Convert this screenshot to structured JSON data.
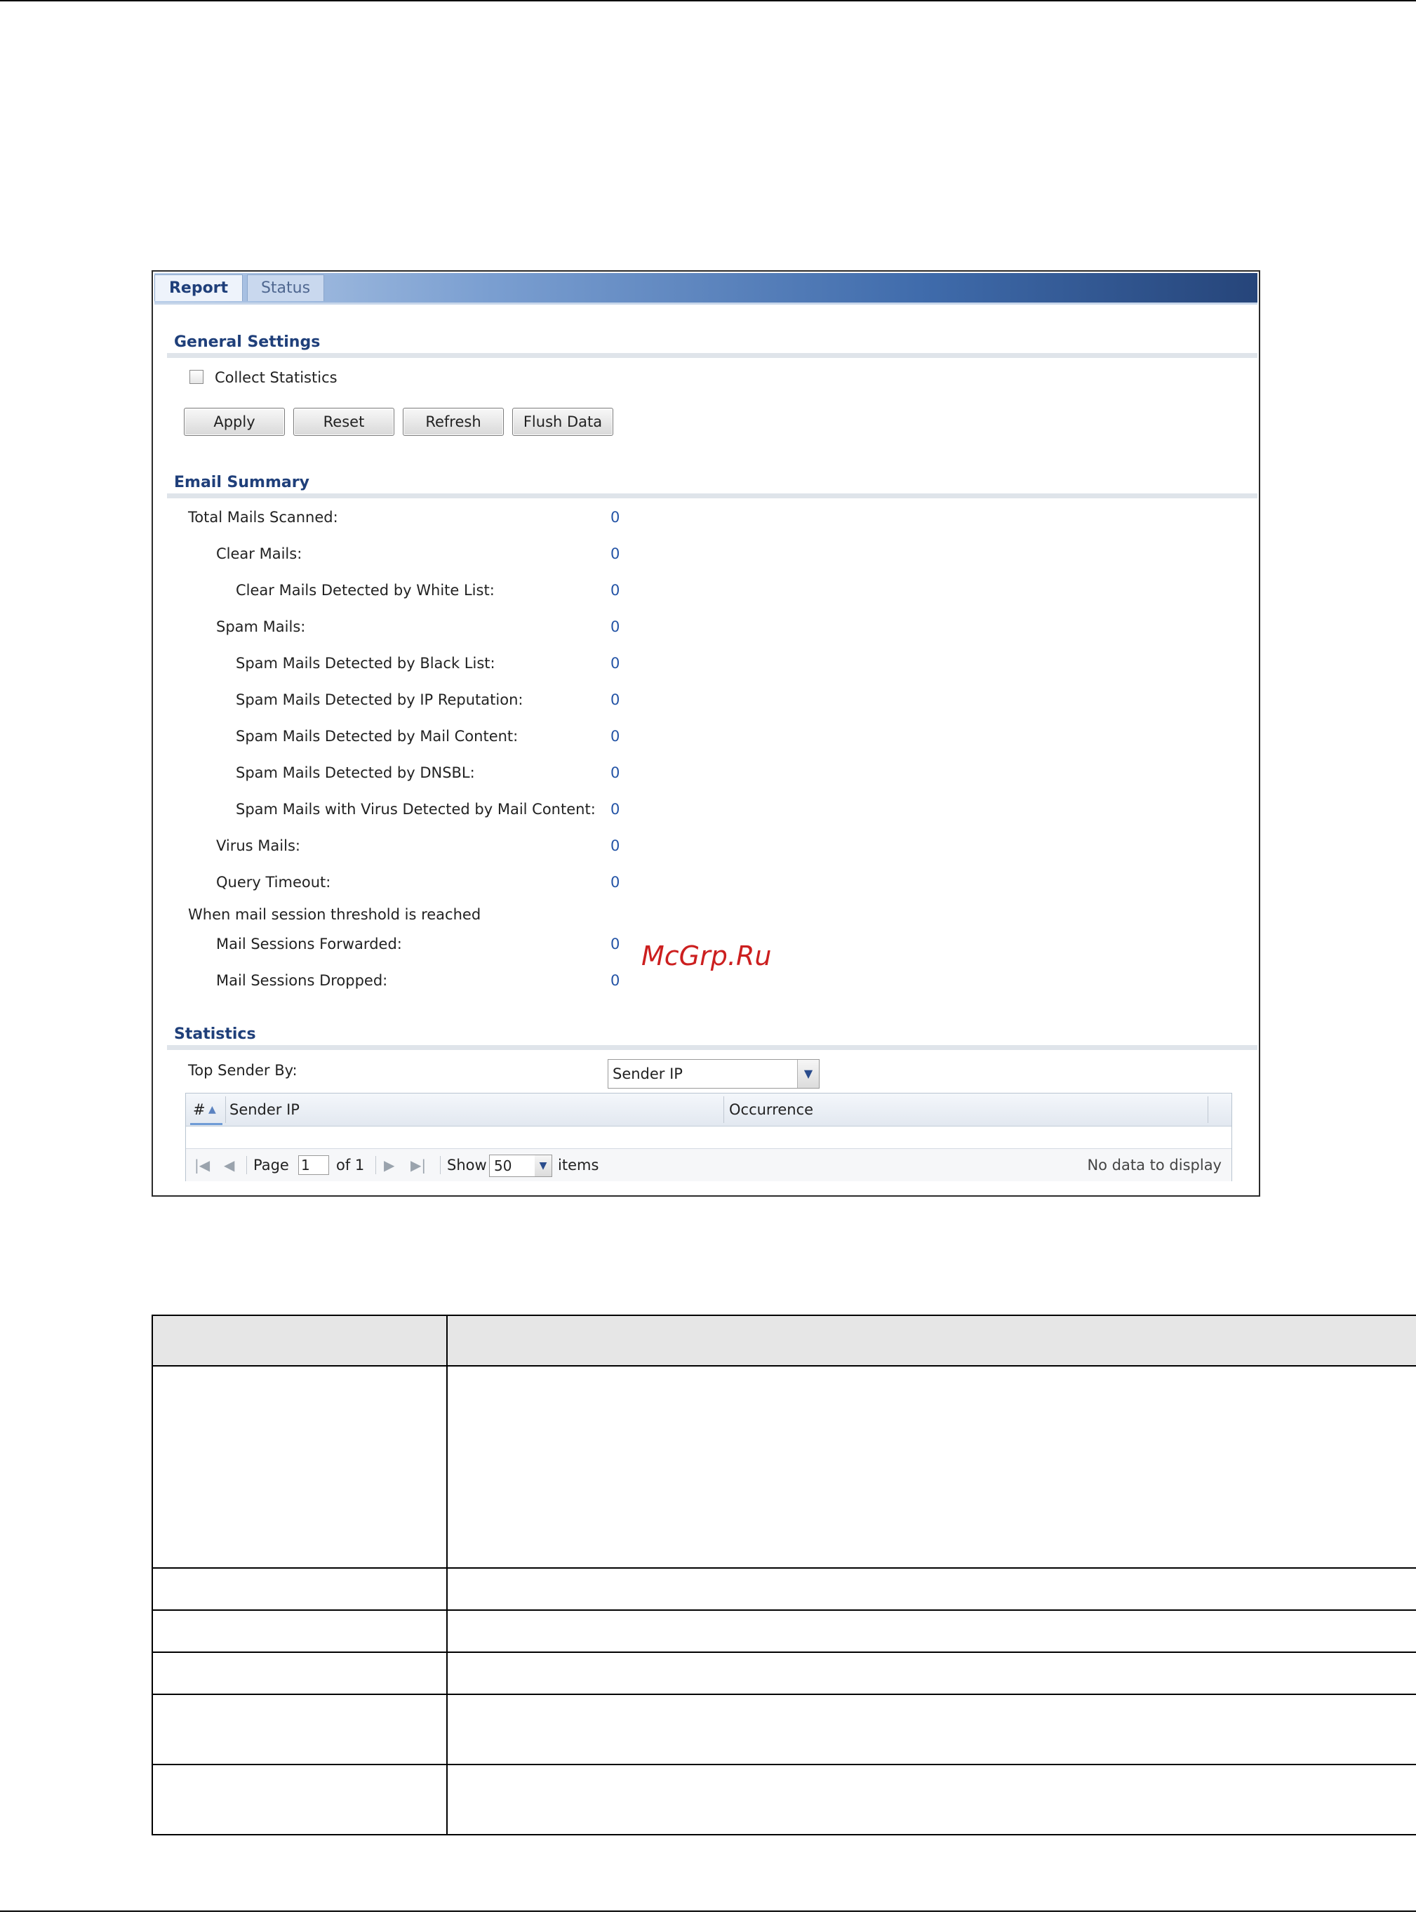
{
  "tabs": [
    {
      "label": "Report"
    },
    {
      "label": "Status"
    }
  ],
  "general_settings": {
    "title": "General Settings",
    "collect_statistics_label": "Collect Statistics",
    "collect_statistics_checked": false,
    "buttons": {
      "apply": "Apply",
      "reset": "Reset",
      "refresh": "Refresh",
      "flush": "Flush Data"
    }
  },
  "email_summary": {
    "title": "Email Summary",
    "rows": [
      {
        "label": "Total Mails Scanned:",
        "value": "0"
      },
      {
        "label": "Clear Mails:",
        "value": "0"
      },
      {
        "label": "Clear Mails Detected by White List:",
        "value": "0"
      },
      {
        "label": "Spam Mails:",
        "value": "0"
      },
      {
        "label": "Spam Mails Detected by Black List:",
        "value": "0"
      },
      {
        "label": "Spam Mails Detected by IP Reputation:",
        "value": "0"
      },
      {
        "label": "Spam Mails Detected by Mail Content:",
        "value": "0"
      },
      {
        "label": "Spam Mails Detected by DNSBL:",
        "value": "0"
      },
      {
        "label": "Spam Mails with Virus Detected by Mail Content:",
        "value": "0"
      },
      {
        "label": "Virus Mails:",
        "value": "0"
      },
      {
        "label": "Query Timeout:",
        "value": "0"
      }
    ],
    "threshold_heading": "When mail session threshold is reached",
    "threshold_rows": [
      {
        "label": "Mail Sessions Forwarded:",
        "value": "0"
      },
      {
        "label": "Mail Sessions Dropped:",
        "value": "0"
      }
    ]
  },
  "statistics": {
    "title": "Statistics",
    "top_sender_label": "Top Sender By:",
    "top_sender_value": "Sender IP",
    "columns": {
      "index": "#",
      "sender_ip": "Sender IP",
      "occurrence": "Occurrence"
    },
    "pager": {
      "page_label": "Page",
      "page_value": "1",
      "of_label": "of 1",
      "show_label": "Show",
      "show_value": "50",
      "items_label": "items",
      "empty_text": "No data to display"
    }
  },
  "watermark": "McGrp.Ru",
  "colors": {
    "accent": "#1f3f7a",
    "value_blue": "#2454a6",
    "watermark_red": "#cc1f1f"
  }
}
